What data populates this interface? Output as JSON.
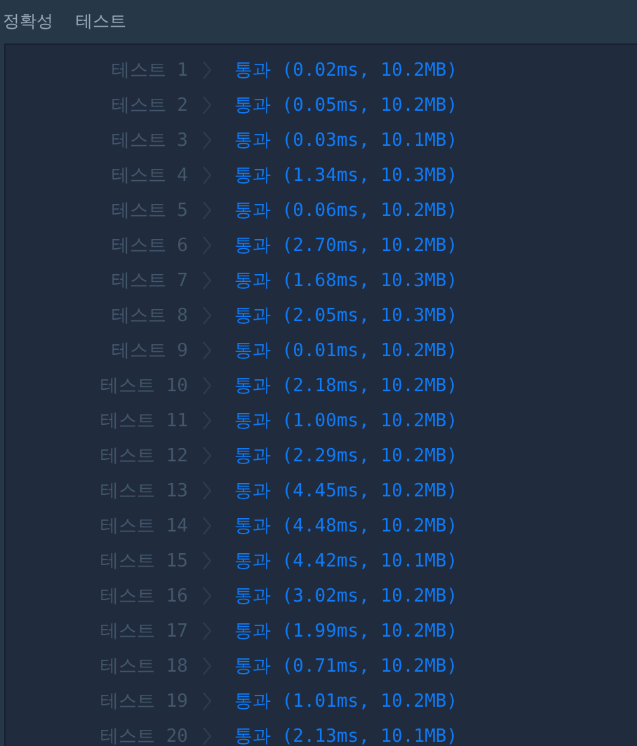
{
  "header": {
    "title": "정확성",
    "subtitle": "테스트"
  },
  "results": [
    {
      "label": "테스트 1",
      "result": "통과 (0.02ms, 10.2MB)"
    },
    {
      "label": "테스트 2",
      "result": "통과 (0.05ms, 10.2MB)"
    },
    {
      "label": "테스트 3",
      "result": "통과 (0.03ms, 10.1MB)"
    },
    {
      "label": "테스트 4",
      "result": "통과 (1.34ms, 10.3MB)"
    },
    {
      "label": "테스트 5",
      "result": "통과 (0.06ms, 10.2MB)"
    },
    {
      "label": "테스트 6",
      "result": "통과 (2.70ms, 10.2MB)"
    },
    {
      "label": "테스트 7",
      "result": "통과 (1.68ms, 10.3MB)"
    },
    {
      "label": "테스트 8",
      "result": "통과 (2.05ms, 10.3MB)"
    },
    {
      "label": "테스트 9",
      "result": "통과 (0.01ms, 10.2MB)"
    },
    {
      "label": "테스트 10",
      "result": "통과 (2.18ms, 10.2MB)"
    },
    {
      "label": "테스트 11",
      "result": "통과 (1.00ms, 10.2MB)"
    },
    {
      "label": "테스트 12",
      "result": "통과 (2.29ms, 10.2MB)"
    },
    {
      "label": "테스트 13",
      "result": "통과 (4.45ms, 10.2MB)"
    },
    {
      "label": "테스트 14",
      "result": "통과 (4.48ms, 10.2MB)"
    },
    {
      "label": "테스트 15",
      "result": "통과 (4.42ms, 10.1MB)"
    },
    {
      "label": "테스트 16",
      "result": "통과 (3.02ms, 10.2MB)"
    },
    {
      "label": "테스트 17",
      "result": "통과 (1.99ms, 10.2MB)"
    },
    {
      "label": "테스트 18",
      "result": "통과 (0.71ms, 10.2MB)"
    },
    {
      "label": "테스트 19",
      "result": "통과 (1.01ms, 10.2MB)"
    },
    {
      "label": "테스트 20",
      "result": "통과 (2.13ms, 10.1MB)"
    }
  ]
}
